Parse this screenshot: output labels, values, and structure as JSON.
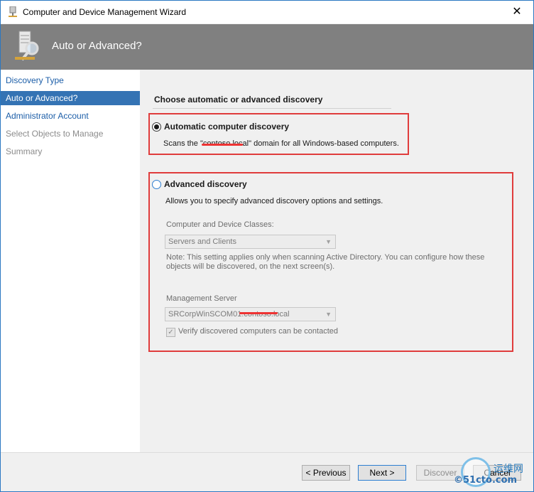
{
  "window": {
    "title": "Computer and Device Management Wizard",
    "close_label": "✕"
  },
  "banner": {
    "title": "Auto or Advanced?"
  },
  "nav": {
    "items": [
      {
        "label": "Discovery Type",
        "state": "link"
      },
      {
        "label": "Auto or Advanced?",
        "state": "selected"
      },
      {
        "label": "Administrator Account",
        "state": "link"
      },
      {
        "label": "Select Objects to Manage",
        "state": "disabled"
      },
      {
        "label": "Summary",
        "state": "disabled"
      }
    ]
  },
  "main": {
    "section_title": "Choose automatic or advanced discovery",
    "automatic": {
      "label": "Automatic computer discovery",
      "selected": true,
      "desc_prefix": "Scans the \"",
      "desc_redacted": "contoso.local",
      "desc_suffix": "\" domain for all Windows-based computers."
    },
    "advanced": {
      "label": "Advanced discovery",
      "selected": false,
      "desc": "Allows you to specify advanced discovery options and settings.",
      "classes_label": "Computer and Device Classes:",
      "classes_value": "Servers and Clients",
      "note": "Note: This setting applies only when scanning Active Directory.  You can configure how these objects will be discovered, on the next screen(s).",
      "server_label": "Management Server",
      "server_value_prefix": "SRCorpWinSCOM01.",
      "server_value_redacted": "contoso.local",
      "verify_label": "Verify discovered computers can be contacted",
      "verify_checked": true
    }
  },
  "buttons": {
    "previous": "< Previous",
    "next": "Next >",
    "discover": "Discover",
    "cancel": "Cancel"
  },
  "watermark": {
    "cn": "运维网",
    "text": "©51cto.com"
  },
  "colors": {
    "accent": "#3473b4",
    "banner": "#808080",
    "highlight_box": "#e03c3c"
  }
}
